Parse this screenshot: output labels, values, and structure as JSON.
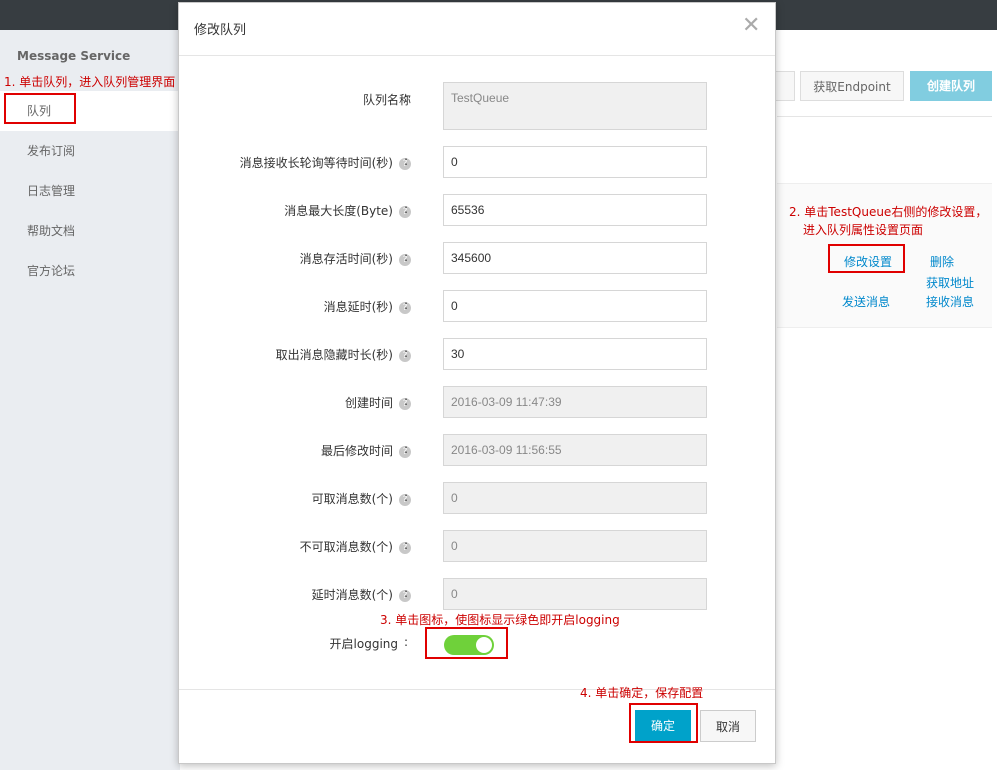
{
  "annotations": {
    "step1": "1. 单击队列，进入队列管理界面",
    "step2_line1": "2. 单击TestQueue右侧的修改设置，",
    "step2_line2": "进入队列属性设置页面",
    "step3": "3. 单击图标，使图标显示绿色即开启logging",
    "step4": "4. 单击确定，保存配置"
  },
  "sidebar": {
    "title": "Message Service",
    "items": [
      {
        "label": "队列",
        "active": true
      },
      {
        "label": "发布订阅",
        "active": false
      },
      {
        "label": "日志管理",
        "active": false
      },
      {
        "label": "帮助文档",
        "active": false
      },
      {
        "label": "官方论坛",
        "active": false
      }
    ]
  },
  "header_buttons": {
    "get_endpoint": "获取Endpoint",
    "create_queue": "创建队列"
  },
  "row_actions": {
    "modify": "修改设置",
    "delete": "删除",
    "get_address": "获取地址",
    "send": "发送消息",
    "receive": "接收消息"
  },
  "dialog": {
    "title": "修改队列",
    "close_icon": "close-icon",
    "fields": [
      {
        "label": "队列名称",
        "value": "TestQueue",
        "readonly": true,
        "help": false
      },
      {
        "label": "消息接收长轮询等待时间(秒)",
        "value": "0",
        "readonly": false,
        "help": true
      },
      {
        "label": "消息最大长度(Byte)",
        "value": "65536",
        "readonly": false,
        "help": true
      },
      {
        "label": "消息存活时间(秒)",
        "value": "345600",
        "readonly": false,
        "help": true
      },
      {
        "label": "消息延时(秒)",
        "value": "0",
        "readonly": false,
        "help": true
      },
      {
        "label": "取出消息隐藏时长(秒)",
        "value": "30",
        "readonly": false,
        "help": true
      },
      {
        "label": "创建时间",
        "value": "2016-03-09 11:47:39",
        "readonly": true,
        "help": true
      },
      {
        "label": "最后修改时间",
        "value": "2016-03-09 11:56:55",
        "readonly": true,
        "help": true
      },
      {
        "label": "可取消息数(个)",
        "value": "0",
        "readonly": true,
        "help": true
      },
      {
        "label": "不可取消息数(个)",
        "value": "0",
        "readonly": true,
        "help": true
      },
      {
        "label": "延时消息数(个)",
        "value": "0",
        "readonly": true,
        "help": true
      }
    ],
    "colon": ":",
    "help_glyph": "?",
    "logging_label": "开启logging",
    "logging_enabled": true,
    "confirm": "确定",
    "cancel": "取消"
  },
  "colors": {
    "accent": "#00a2ca",
    "toggle_on": "#6fd13a",
    "annotation_red": "#cc0000"
  }
}
